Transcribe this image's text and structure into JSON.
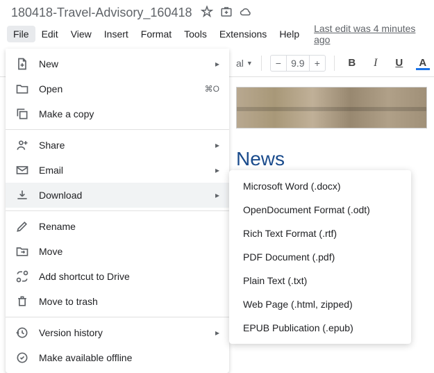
{
  "doc": {
    "title": "180418-Travel-Advisory_160418"
  },
  "menubar": {
    "items": [
      "File",
      "Edit",
      "View",
      "Insert",
      "Format",
      "Tools",
      "Extensions",
      "Help"
    ],
    "active_index": 0
  },
  "last_edit": "Last edit was 4 minutes ago",
  "toolbar": {
    "style_dd": "al",
    "font_size": "9.9"
  },
  "format_buttons": {
    "bold": "B",
    "italic": "I",
    "underline": "U",
    "color": "A"
  },
  "file_menu": {
    "groups": [
      {
        "items": [
          {
            "key": "new",
            "label": "New",
            "icon": "file-plus-icon",
            "tail": "▸"
          },
          {
            "key": "open",
            "label": "Open",
            "icon": "folder-icon",
            "tail": "⌘O"
          },
          {
            "key": "copy",
            "label": "Make a copy",
            "icon": "copy-icon"
          }
        ]
      },
      {
        "items": [
          {
            "key": "share",
            "label": "Share",
            "icon": "person-plus-icon",
            "tail": "▸"
          },
          {
            "key": "email",
            "label": "Email",
            "icon": "mail-icon",
            "tail": "▸"
          },
          {
            "key": "download",
            "label": "Download",
            "icon": "download-icon",
            "tail": "▸",
            "hovered": true
          }
        ]
      },
      {
        "items": [
          {
            "key": "rename",
            "label": "Rename",
            "icon": "pencil-icon"
          },
          {
            "key": "move",
            "label": "Move",
            "icon": "move-icon"
          },
          {
            "key": "shortcut",
            "label": "Add shortcut to Drive",
            "icon": "shortcut-icon"
          },
          {
            "key": "trash",
            "label": "Move to trash",
            "icon": "trash-icon"
          }
        ]
      },
      {
        "items": [
          {
            "key": "history",
            "label": "Version history",
            "icon": "history-icon",
            "tail": "▸"
          },
          {
            "key": "offline",
            "label": "Make available offline",
            "icon": "offline-icon"
          }
        ]
      }
    ]
  },
  "download_submenu": [
    "Microsoft Word (.docx)",
    "OpenDocument Format (.odt)",
    "Rich Text Format (.rtf)",
    "PDF Document (.pdf)",
    "Plain Text (.txt)",
    "Web Page (.html, zipped)",
    "EPUB Publication (.epub)"
  ],
  "doc_content": {
    "heading": "News"
  }
}
